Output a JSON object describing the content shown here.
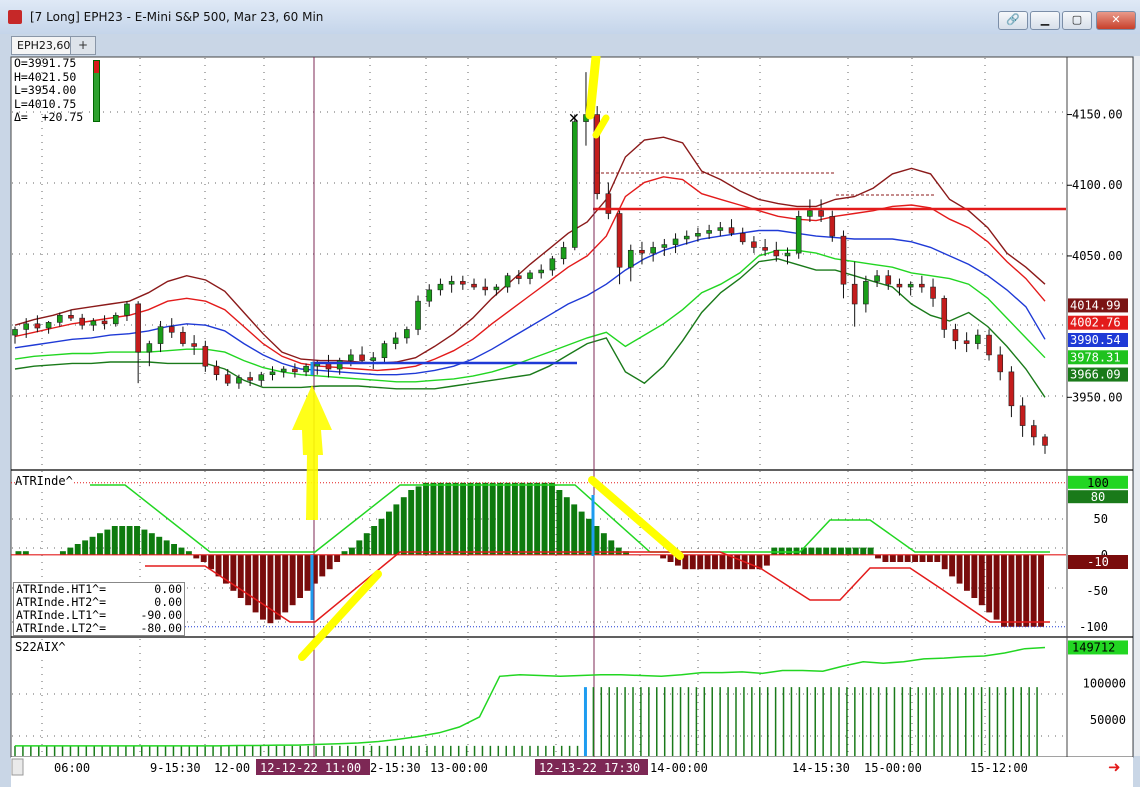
{
  "window": {
    "title": "[7 Long]  EPH23 - E-Mini S&P 500, Mar 23, 60 Min",
    "buttons": [
      "link",
      "minimize",
      "maximize",
      "close"
    ]
  },
  "tabs": [
    {
      "label": "EPH23,60"
    },
    {
      "label": "+"
    }
  ],
  "ohlc_readout": {
    "open": "O=3991.75",
    "high": "H=4021.50",
    "low": "L=3954.00",
    "last": "L=4010.75",
    "delta": "Δ=  +20.75"
  },
  "study_labels": {
    "atr": "ATRInde^",
    "s22": "S22AIX^"
  },
  "atr_values": [
    {
      "name": "ATRInde.HT1^=",
      "value": "0.00"
    },
    {
      "name": "ATRInde.HT2^=",
      "value": "0.00"
    },
    {
      "name": "ATRInde.LT1^=",
      "value": "-90.00"
    },
    {
      "name": "ATRInde.LT2^=",
      "value": "-80.00"
    }
  ],
  "colors": {
    "up": "#1a9e1a",
    "down": "#c41c1c",
    "upper_outer": "#8b1a1a",
    "upper_inner": "#e31b1b",
    "mid": "#1f3ad6",
    "lower_inner": "#22d622",
    "lower_outer": "#1a7a1a",
    "highlight": "#ffff00",
    "hist_up": "#0e7a0e",
    "hist_down": "#7a0c0c",
    "cursor_tag": "#7d2855"
  },
  "chart_data": [
    {
      "type": "line",
      "panel": "price",
      "y_axis": {
        "ticks": [
          "4150.00",
          "4100.00",
          "4050.00",
          "3950.00"
        ],
        "ylim": [
          3900,
          4190
        ]
      },
      "price_tags": [
        "4014.99",
        "4002.76",
        "3990.54",
        "3978.31",
        "3966.09"
      ],
      "candles": [
        [
          3994,
          4000,
          3988,
          3998
        ],
        [
          3998,
          4006,
          3992,
          4002
        ],
        [
          4002,
          4008,
          3996,
          3999
        ],
        [
          3999,
          4004,
          3995,
          4003
        ],
        [
          4003,
          4010,
          4000,
          4008
        ],
        [
          4008,
          4012,
          4004,
          4006
        ],
        [
          4006,
          4009,
          3998,
          4001
        ],
        [
          4001,
          4006,
          3997,
          4004
        ],
        [
          4004,
          4008,
          3998,
          4002
        ],
        [
          4002,
          4010,
          4000,
          4008
        ],
        [
          4008,
          4018,
          4004,
          4016
        ],
        [
          4016,
          4018,
          3960,
          3982
        ],
        [
          3982,
          3990,
          3972,
          3988
        ],
        [
          3988,
          4004,
          3982,
          4000
        ],
        [
          4000,
          4006,
          3992,
          3996
        ],
        [
          3996,
          4000,
          3986,
          3988
        ],
        [
          3988,
          3994,
          3980,
          3986
        ],
        [
          3986,
          3990,
          3968,
          3972
        ],
        [
          3972,
          3976,
          3962,
          3966
        ],
        [
          3966,
          3970,
          3958,
          3960
        ],
        [
          3960,
          3966,
          3956,
          3964
        ],
        [
          3964,
          3968,
          3958,
          3962
        ],
        [
          3962,
          3968,
          3958,
          3966
        ],
        [
          3966,
          3972,
          3962,
          3968
        ],
        [
          3968,
          3972,
          3964,
          3970
        ],
        [
          3970,
          3974,
          3964,
          3968
        ],
        [
          3968,
          3974,
          3965,
          3972
        ],
        [
          3972,
          3976,
          3966,
          3974
        ],
        [
          3974,
          3980,
          3964,
          3970
        ],
        [
          3970,
          3978,
          3966,
          3976
        ],
        [
          3976,
          3984,
          3972,
          3980
        ],
        [
          3980,
          3986,
          3974,
          3976
        ],
        [
          3976,
          3982,
          3970,
          3978
        ],
        [
          3978,
          3990,
          3975,
          3988
        ],
        [
          3988,
          3996,
          3984,
          3992
        ],
        [
          3992,
          4000,
          3988,
          3998
        ],
        [
          3998,
          4022,
          3994,
          4018
        ],
        [
          4018,
          4030,
          4014,
          4026
        ],
        [
          4026,
          4034,
          4022,
          4030
        ],
        [
          4030,
          4036,
          4024,
          4032
        ],
        [
          4032,
          4036,
          4026,
          4030
        ],
        [
          4030,
          4034,
          4026,
          4028
        ],
        [
          4028,
          4034,
          4022,
          4026
        ],
        [
          4026,
          4030,
          4022,
          4028
        ],
        [
          4028,
          4038,
          4024,
          4036
        ],
        [
          4036,
          4040,
          4030,
          4034
        ],
        [
          4034,
          4040,
          4030,
          4038
        ],
        [
          4038,
          4044,
          4034,
          4040
        ],
        [
          4040,
          4050,
          4036,
          4048
        ],
        [
          4048,
          4060,
          4044,
          4056
        ],
        [
          4056,
          4150,
          4054,
          4145
        ],
        [
          4145,
          4180,
          4128,
          4150
        ],
        [
          4150,
          4156,
          4090,
          4094
        ],
        [
          4094,
          4102,
          4076,
          4080
        ],
        [
          4080,
          4082,
          4030,
          4042
        ],
        [
          4042,
          4058,
          4032,
          4054
        ],
        [
          4054,
          4060,
          4044,
          4052
        ],
        [
          4052,
          4060,
          4046,
          4056
        ],
        [
          4056,
          4062,
          4050,
          4058
        ],
        [
          4058,
          4066,
          4052,
          4062
        ],
        [
          4062,
          4068,
          4058,
          4064
        ],
        [
          4064,
          4070,
          4060,
          4066
        ],
        [
          4066,
          4072,
          4062,
          4068
        ],
        [
          4068,
          4074,
          4064,
          4070
        ],
        [
          4070,
          4076,
          4064,
          4066
        ],
        [
          4066,
          4070,
          4058,
          4060
        ],
        [
          4060,
          4064,
          4052,
          4056
        ],
        [
          4056,
          4062,
          4050,
          4054
        ],
        [
          4054,
          4060,
          4046,
          4050
        ],
        [
          4050,
          4056,
          4044,
          4052
        ],
        [
          4052,
          4082,
          4048,
          4078
        ],
        [
          4078,
          4090,
          4074,
          4082
        ],
        [
          4082,
          4090,
          4074,
          4078
        ],
        [
          4078,
          4082,
          4060,
          4064
        ],
        [
          4064,
          4068,
          4020,
          4030
        ],
        [
          4030,
          4046,
          4000,
          4016
        ],
        [
          4016,
          4036,
          4010,
          4032
        ],
        [
          4032,
          4040,
          4028,
          4036
        ],
        [
          4036,
          4040,
          4026,
          4030
        ],
        [
          4030,
          4034,
          4022,
          4028
        ],
        [
          4028,
          4032,
          4022,
          4030
        ],
        [
          4030,
          4036,
          4024,
          4028
        ],
        [
          4028,
          4034,
          4014,
          4020
        ],
        [
          4020,
          4022,
          3992,
          3998
        ],
        [
          3998,
          4002,
          3984,
          3990
        ],
        [
          3990,
          3996,
          3982,
          3988
        ],
        [
          3988,
          3998,
          3984,
          3994
        ],
        [
          3994,
          3998,
          3976,
          3980
        ],
        [
          3980,
          3986,
          3962,
          3968
        ],
        [
          3968,
          3972,
          3936,
          3944
        ],
        [
          3944,
          3950,
          3922,
          3930
        ],
        [
          3930,
          3934,
          3916,
          3922
        ],
        [
          3922,
          3924,
          3910,
          3916
        ]
      ],
      "series": [
        {
          "values": [
            4001,
            4005,
            4008,
            4012,
            4014,
            4016,
            4018,
            4024,
            4032,
            4036,
            4033,
            4025,
            4010,
            3995,
            3982,
            3977,
            3976,
            3976,
            3975,
            3974,
            3975,
            3978,
            3986,
            3995,
            4006,
            4020,
            4032,
            4044,
            4055,
            4066,
            4074,
            4090,
            4120,
            4132,
            4134,
            4130,
            4110,
            4104,
            4096,
            4090,
            4087,
            4085,
            4085,
            4090,
            4092,
            4098,
            4108,
            4112,
            4108,
            4090,
            4082,
            4070,
            4052,
            4042,
            4030
          ]
        },
        {
          "values": [
            3993,
            3996,
            3999,
            4002,
            4004,
            4006,
            4008,
            4012,
            4018,
            4020,
            4018,
            4012,
            4000,
            3988,
            3979,
            3974,
            3972,
            3971,
            3970,
            3969,
            3970,
            3972,
            3977,
            3983,
            3991,
            4002,
            4012,
            4022,
            4032,
            4042,
            4050,
            4064,
            4092,
            4102,
            4106,
            4104,
            4094,
            4090,
            4086,
            4082,
            4078,
            4076,
            4075,
            4078,
            4080,
            4082,
            4085,
            4086,
            4084,
            4076,
            4070,
            4060,
            4046,
            4034,
            4018
          ]
        },
        {
          "values": [
            3985,
            3987,
            3989,
            3991,
            3992,
            3994,
            3995,
            3997,
            4000,
            4002,
            4001,
            3997,
            3988,
            3980,
            3974,
            3970,
            3969,
            3968,
            3967,
            3966,
            3966,
            3967,
            3969,
            3972,
            3977,
            3984,
            3992,
            4000,
            4008,
            4016,
            4022,
            4030,
            4040,
            4048,
            4054,
            4058,
            4062,
            4064,
            4066,
            4068,
            4068,
            4066,
            4064,
            4063,
            4062,
            4062,
            4062,
            4060,
            4056,
            4050,
            4044,
            4036,
            4026,
            4014,
            3991
          ]
        },
        {
          "values": [
            3977,
            3979,
            3980,
            3981,
            3981,
            3982,
            3982,
            3982,
            3983,
            3984,
            3984,
            3982,
            3976,
            3971,
            3968,
            3966,
            3965,
            3964,
            3963,
            3962,
            3961,
            3961,
            3962,
            3963,
            3965,
            3968,
            3972,
            3977,
            3982,
            3987,
            3992,
            3996,
            3986,
            3994,
            4002,
            4012,
            4024,
            4030,
            4038,
            4050,
            4054,
            4054,
            4052,
            4048,
            4046,
            4044,
            4042,
            4038,
            4036,
            4034,
            4030,
            4020,
            4006,
            3992,
            3978
          ]
        },
        {
          "values": [
            3970,
            3972,
            3973,
            3974,
            3974,
            3975,
            3975,
            3975,
            3974,
            3974,
            3974,
            3970,
            3962,
            3957,
            3957,
            3957,
            3958,
            3958,
            3958,
            3957,
            3956,
            3956,
            3956,
            3958,
            3960,
            3962,
            3964,
            3966,
            3972,
            3980,
            3988,
            3992,
            3968,
            3960,
            3972,
            3990,
            4010,
            4024,
            4034,
            4046,
            4048,
            4044,
            4040,
            4040,
            4036,
            4032,
            4028,
            4016,
            4008,
            4004,
            4010,
            4000,
            3986,
            3970,
            3950
          ]
        }
      ]
    },
    {
      "type": "bar",
      "panel": "ATRInde^",
      "y_axis": {
        "ticks": [
          "100",
          "80",
          "50",
          "0",
          "-10",
          "-50",
          "-100"
        ],
        "ylim": [
          -110,
          115
        ]
      },
      "values": [
        5,
        5,
        0,
        0,
        0,
        0,
        5,
        10,
        15,
        20,
        25,
        30,
        35,
        40,
        40,
        40,
        40,
        35,
        30,
        25,
        20,
        15,
        10,
        5,
        -5,
        -10,
        -20,
        -30,
        -40,
        -50,
        -60,
        -70,
        -80,
        -90,
        -95,
        -90,
        -80,
        -70,
        -60,
        -50,
        -40,
        -30,
        -20,
        -10,
        5,
        10,
        20,
        30,
        40,
        50,
        60,
        70,
        80,
        90,
        95,
        100,
        100,
        100,
        100,
        100,
        100,
        100,
        100,
        100,
        100,
        100,
        100,
        100,
        100,
        100,
        100,
        100,
        100,
        90,
        80,
        70,
        60,
        50,
        40,
        30,
        20,
        10,
        5,
        0,
        0,
        0,
        0,
        -5,
        -10,
        -15,
        -20,
        -20,
        -20,
        -20,
        -20,
        -20,
        -20,
        -20,
        -20,
        -20,
        -20,
        -15,
        10,
        10,
        10,
        10,
        10,
        10,
        10,
        10,
        10,
        10,
        10,
        10,
        10,
        10,
        -5,
        -10,
        -10,
        -10,
        -10,
        -10,
        -10,
        -10,
        -10,
        -20,
        -30,
        -40,
        -50,
        -60,
        -70,
        -80,
        -90,
        -100,
        -100,
        -100,
        -100,
        -100,
        -100
      ]
    },
    {
      "type": "area",
      "panel": "S22AIX^",
      "y_axis": {
        "ticks": [
          "149712",
          "100000",
          "50000"
        ],
        "ylim": [
          0,
          160000
        ]
      },
      "x_labels": [
        "06:00",
        "9-15:30",
        "12-00",
        "12-12-22  11:00",
        "2-15:30",
        "13-00:00",
        "12-13-22  17:30",
        "14-00:00",
        "14-15:30",
        "15-00:00",
        "15-12:00"
      ],
      "values": [
        14000,
        14000,
        14000,
        14000,
        14000,
        14000,
        14000,
        14000,
        14000,
        14000,
        14000,
        14500,
        14500,
        15000,
        15000,
        16000,
        17000,
        18000,
        20000,
        23000,
        27000,
        32000,
        40000,
        54000,
        110000,
        112000,
        111000,
        110000,
        111000,
        112000,
        112000,
        111000,
        110000,
        112000,
        115000,
        115000,
        116000,
        114000,
        118000,
        118000,
        117000,
        124000,
        130000,
        128000,
        130000,
        134000,
        135000,
        137000,
        138000,
        142000,
        148000,
        149712
      ]
    }
  ]
}
